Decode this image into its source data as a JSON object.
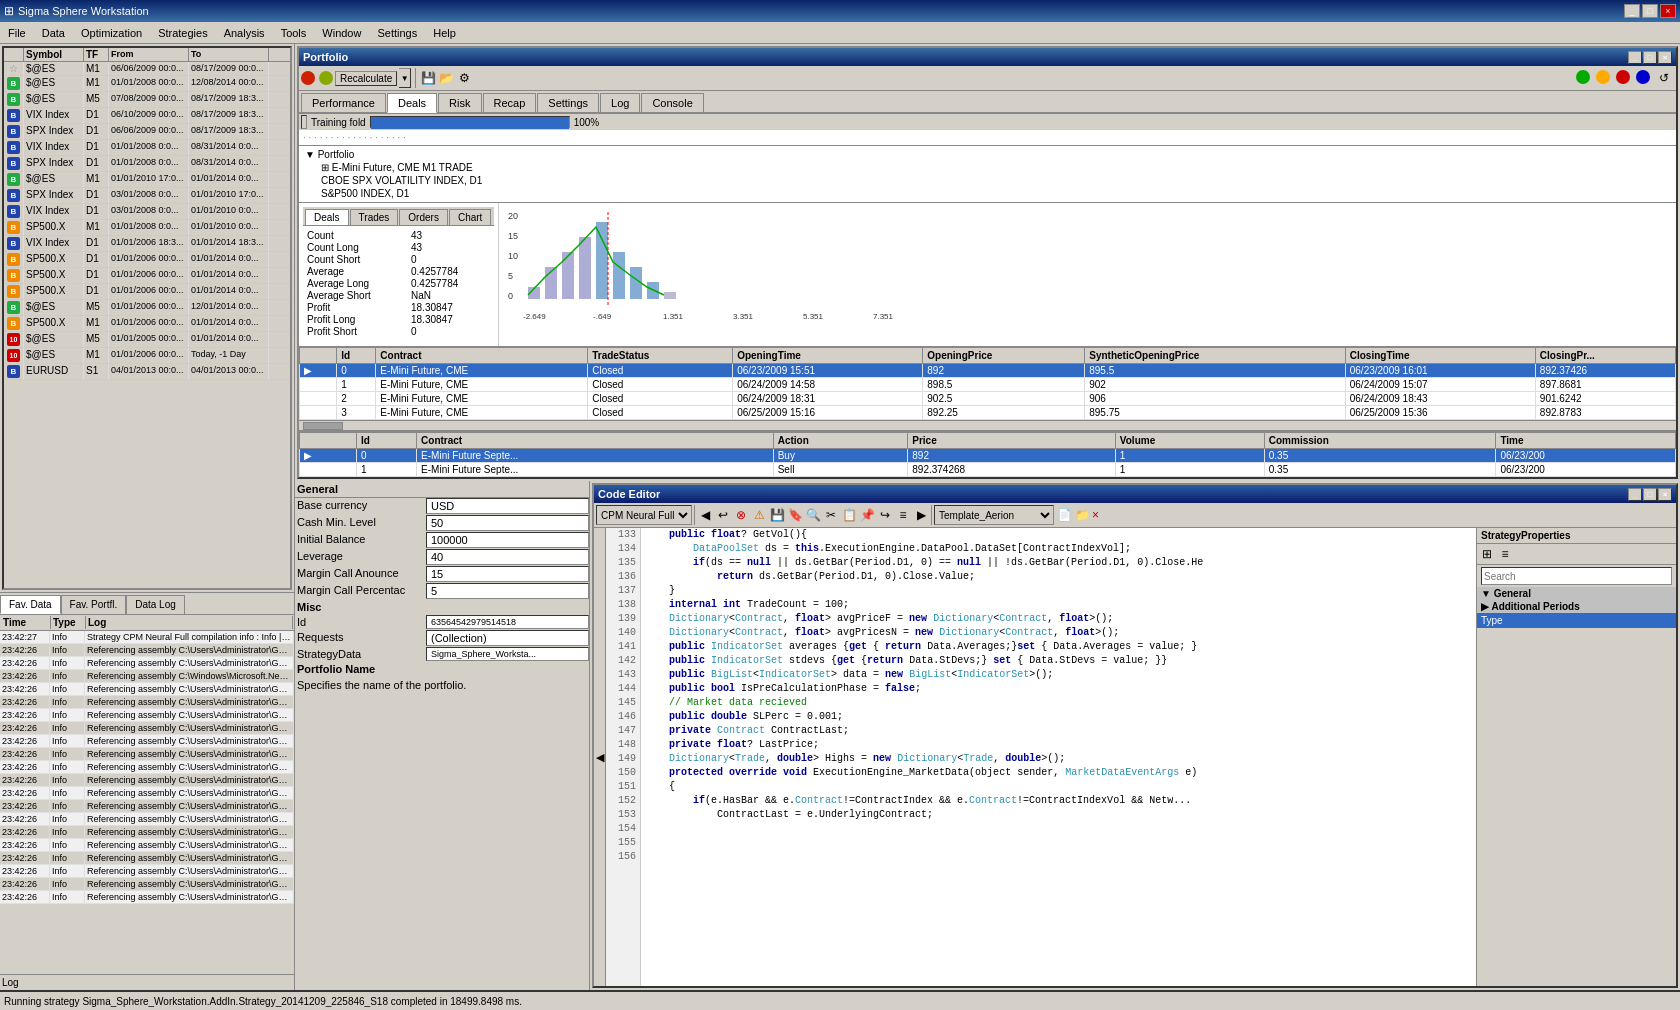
{
  "titleBar": {
    "title": "Sigma Sphere Workstation",
    "buttons": [
      "_",
      "□",
      "×"
    ]
  },
  "menuBar": {
    "items": [
      "File",
      "Data",
      "Optimization",
      "Strategies",
      "Analysis",
      "Tools",
      "Window",
      "Settings",
      "Help"
    ]
  },
  "symbolTable": {
    "headers": [
      "",
      "Symbol",
      "TF",
      "From",
      "To"
    ],
    "rows": [
      {
        "icon": "star",
        "symbol": "$@ES",
        "tf": "M1",
        "from": "06/06/2009 00:0...",
        "to": "08/17/2009 00:0...",
        "iconType": "star"
      },
      {
        "icon": "B",
        "symbol": "$@ES",
        "tf": "M1",
        "from": "01/01/2008 00:0...",
        "to": "12/08/2014 00:0...",
        "iconType": "b-green"
      },
      {
        "icon": "B",
        "symbol": "$@ES",
        "tf": "M5",
        "from": "07/08/2009 00:0...",
        "to": "08/17/2009 18:3...",
        "iconType": "b-green"
      },
      {
        "icon": "B",
        "symbol": "VIX Index",
        "tf": "D1",
        "from": "06/10/2009 00:0...",
        "to": "08/17/2009 18:3...",
        "iconType": "b-blue"
      },
      {
        "icon": "B",
        "symbol": "SPX Index",
        "tf": "D1",
        "from": "06/06/2009 00:0...",
        "to": "08/17/2009 18:3...",
        "iconType": "b-blue"
      },
      {
        "icon": "B",
        "symbol": "VIX Index",
        "tf": "D1",
        "from": "01/01/2008 0:0...",
        "to": "08/31/2014 0:0...",
        "iconType": "b-blue"
      },
      {
        "icon": "B",
        "symbol": "SPX Index",
        "tf": "D1",
        "from": "01/01/2008 0:0...",
        "to": "08/31/2014 0:0...",
        "iconType": "b-blue"
      },
      {
        "icon": "B",
        "symbol": "$@ES",
        "tf": "M1",
        "from": "01/01/2010 17:0...",
        "to": "01/01/2014 0:0...",
        "iconType": "b-green"
      },
      {
        "icon": "B",
        "symbol": "SPX Index",
        "tf": "D1",
        "from": "03/01/2008 0:0...",
        "to": "01/01/2010 17:0...",
        "iconType": "b-blue"
      },
      {
        "icon": "B",
        "symbol": "VIX Index",
        "tf": "D1",
        "from": "03/01/2008 0:0...",
        "to": "01/01/2010 0:0...",
        "iconType": "b-blue"
      },
      {
        "icon": "B",
        "symbol": "SP500.X",
        "tf": "M1",
        "from": "01/01/2008 0:0...",
        "to": "01/01/2010 0:0...",
        "iconType": "b-orange"
      },
      {
        "icon": "B",
        "symbol": "VIX Index",
        "tf": "D1",
        "from": "01/01/2006 18:3...",
        "to": "01/01/2014 18:3...",
        "iconType": "b-blue"
      },
      {
        "icon": "B",
        "symbol": "SP500.X",
        "tf": "D1",
        "from": "01/01/2006 00:0...",
        "to": "01/01/2014 0:0...",
        "iconType": "b-orange"
      },
      {
        "icon": "B",
        "symbol": "SP500.X",
        "tf": "D1",
        "from": "01/01/2006 00:0...",
        "to": "01/01/2014 0:0...",
        "iconType": "b-orange"
      },
      {
        "icon": "B",
        "symbol": "SP500.X",
        "tf": "D1",
        "from": "01/01/2006 00:0...",
        "to": "01/01/2014 0:0...",
        "iconType": "b-orange"
      },
      {
        "icon": "B",
        "symbol": "$@ES",
        "tf": "M5",
        "from": "01/01/2006 00:0...",
        "to": "12/01/2014 0:0...",
        "iconType": "b-green"
      },
      {
        "icon": "B",
        "symbol": "SP500.X",
        "tf": "M1",
        "from": "01/01/2006 00:0...",
        "to": "01/01/2014 0:0...",
        "iconType": "b-orange"
      },
      {
        "icon": "10",
        "symbol": "$@ES",
        "tf": "M5",
        "from": "01/01/2005 00:0...",
        "to": "01/01/2014 0:0...",
        "iconType": "ten-red"
      },
      {
        "icon": "10",
        "symbol": "$@ES",
        "tf": "M1",
        "from": "01/01/2006 00:0...",
        "to": "Today, -1 Day",
        "iconType": "ten-red"
      },
      {
        "icon": "B",
        "symbol": "EURUSD",
        "tf": "S1",
        "from": "04/01/2013 00:0...",
        "to": "04/01/2013 00:0...",
        "iconType": "b-blue"
      }
    ]
  },
  "leftTabs": [
    "Fav. Data",
    "Fav. Portfl.",
    "Data Log"
  ],
  "logPanel": {
    "headers": [
      "Time",
      "Type",
      "Log"
    ],
    "rows": [
      {
        "time": "23:42:27",
        "type": "Info",
        "log": "Strategy CPM Neural Full compilation info : Info | Compi"
      },
      {
        "time": "23:42:26",
        "type": "Info",
        "log": "Referencing assembly C:\\Users\\Administrator\\Google"
      },
      {
        "time": "23:42:26",
        "type": "Info",
        "log": "Referencing assembly C:\\Users\\Administrator\\Google"
      },
      {
        "time": "23:42:26",
        "type": "Info",
        "log": "Referencing assembly C:\\Windows\\Microsoft.Net\\ass"
      },
      {
        "time": "23:42:26",
        "type": "Info",
        "log": "Referencing assembly C:\\Users\\Administrator\\Google"
      },
      {
        "time": "23:42:26",
        "type": "Info",
        "log": "Referencing assembly C:\\Users\\Administrator\\Google"
      },
      {
        "time": "23:42:26",
        "type": "Info",
        "log": "Referencing assembly C:\\Users\\Administrator\\Google"
      },
      {
        "time": "23:42:26",
        "type": "Info",
        "log": "Referencing assembly C:\\Users\\Administrator\\Google"
      },
      {
        "time": "23:42:26",
        "type": "Info",
        "log": "Referencing assembly C:\\Users\\Administrator\\Google"
      },
      {
        "time": "23:42:26",
        "type": "Info",
        "log": "Referencing assembly C:\\Users\\Administrator\\Google"
      },
      {
        "time": "23:42:26",
        "type": "Info",
        "log": "Referencing assembly C:\\Users\\Administrator\\Google"
      },
      {
        "time": "23:42:26",
        "type": "Info",
        "log": "Referencing assembly C:\\Users\\Administrator\\Google"
      },
      {
        "time": "23:42:26",
        "type": "Info",
        "log": "Referencing assembly C:\\Users\\Administrator\\Google"
      },
      {
        "time": "23:42:26",
        "type": "Info",
        "log": "Referencing assembly C:\\Users\\Administrator\\Google"
      },
      {
        "time": "23:42:26",
        "type": "Info",
        "log": "Referencing assembly C:\\Users\\Administrator\\Google"
      },
      {
        "time": "23:42:26",
        "type": "Info",
        "log": "Referencing assembly C:\\Users\\Administrator\\Google"
      },
      {
        "time": "23:42:26",
        "type": "Info",
        "log": "Referencing assembly C:\\Users\\Administrator\\Google"
      },
      {
        "time": "23:42:26",
        "type": "Info",
        "log": "Referencing assembly C:\\Users\\Administrator\\Google"
      },
      {
        "time": "23:42:26",
        "type": "Info",
        "log": "Referencing assembly C:\\Users\\Administrator\\Google"
      },
      {
        "time": "23:42:26",
        "type": "Info",
        "log": "Referencing assembly C:\\Users\\Administrator\\Google"
      },
      {
        "time": "23:42:26",
        "type": "Info",
        "log": "Referencing assembly C:\\Users\\Administrator\\Google"
      }
    ]
  },
  "logLabel": "Log",
  "portfolio": {
    "title": "Portfolio",
    "tabs": [
      "Performance",
      "Deals",
      "Risk",
      "Recap",
      "Settings",
      "Log",
      "Console"
    ],
    "activeTab": "Deals",
    "dealsTabs": [
      "Deals",
      "Trades",
      "Orders",
      "Chart"
    ],
    "activeDealsTab": "Deals",
    "stats": {
      "count": "43",
      "countLong": "43",
      "countShort": "0",
      "average": "0.4257784",
      "averageLong": "0.4257784",
      "averageShort": "NaN",
      "profit": "18.30847",
      "profitLong": "18.30847",
      "profitShort": "0"
    },
    "tradesTableHeaders": [
      "Id",
      "Contract",
      "TradeStatus",
      "OpeningTime",
      "OpeningPrice",
      "SyntheticOpeningPrice",
      "ClosingTime",
      "ClosingPr..."
    ],
    "tradesRows": [
      {
        "id": "0",
        "contract": "E-Mini Future, CME",
        "status": "Closed",
        "openTime": "06/23/2009 15:51",
        "openPrice": "892",
        "synthOpen": "895.5",
        "closeTime": "06/23/2009 16:01",
        "closePrice": "892.37426"
      },
      {
        "id": "1",
        "contract": "E-Mini Future, CME",
        "status": "Closed",
        "openTime": "06/24/2009 14:58",
        "openPrice": "898.5",
        "synthOpen": "902",
        "closeTime": "06/24/2009 15:07",
        "closePrice": "897.8681"
      },
      {
        "id": "2",
        "contract": "E-Mini Future, CME",
        "status": "Closed",
        "openTime": "06/24/2009 18:31",
        "openPrice": "902.5",
        "synthOpen": "906",
        "closeTime": "06/24/2009 18:43",
        "closePrice": "901.6242"
      },
      {
        "id": "3",
        "contract": "E-Mini Future, CME",
        "status": "Closed",
        "openTime": "06/25/2009 15:16",
        "openPrice": "892.25",
        "synthOpen": "895.75",
        "closeTime": "06/25/2009 15:36",
        "closePrice": "892.8783"
      }
    ],
    "ordersTableHeaders": [
      "Id",
      "Contract",
      "Action",
      "Price",
      "Volume",
      "Commission",
      "Time"
    ],
    "ordersRows": [
      {
        "id": "0",
        "contract": "E-Mini Future Septe...",
        "action": "Buy",
        "price": "892",
        "volume": "1",
        "commission": "0.35",
        "time": "06/23/200"
      },
      {
        "id": "1",
        "contract": "E-Mini Future Septe...",
        "action": "Sell",
        "price": "892.374268",
        "volume": "1",
        "commission": "0.35",
        "time": "06/23/200"
      }
    ]
  },
  "general": {
    "title": "General",
    "baseCurrency": {
      "label": "Base currency",
      "value": "USD"
    },
    "cashMin": {
      "label": "Cash Min. Level",
      "value": "50"
    },
    "initialBalance": {
      "label": "Initial Balance",
      "value": "100000"
    },
    "leverage": {
      "label": "Leverage",
      "value": "40"
    },
    "marginCallAnnounce": {
      "label": "Margin Call Anounce",
      "value": "15"
    },
    "marginCallPercentage": {
      "label": "Margin Call Percentac",
      "value": "5"
    },
    "portfolioName": {
      "label": "Portfolio Name",
      "value": ""
    },
    "misc": {
      "id": "63564542979514518",
      "requests": "(Collection)",
      "strategyData": "Sigma_Sphere_Worksta..."
    },
    "description": "Specifies the name of the portfolio."
  },
  "codeEditor": {
    "title": "Code Editor",
    "strategyName": "CPM Neural Full",
    "templateName": "Template_Aerion",
    "lines": [
      {
        "num": 133,
        "code": ""
      },
      {
        "num": 134,
        "code": "    public float? GetVol(){"
      },
      {
        "num": 135,
        "code": "        DataPoolSet ds = this.ExecutionEngine.DataPool.DataSet[ContractIndexVol];"
      },
      {
        "num": 136,
        "code": "        if(ds == null || ds.GetBar(Period.D1, 0) == null || !ds.GetBar(Period.D1, 0).Close.He"
      },
      {
        "num": 137,
        "code": "            return ds.GetBar(Period.D1, 0).Close.Value;"
      },
      {
        "num": 138,
        "code": "    }"
      },
      {
        "num": 139,
        "code": ""
      },
      {
        "num": 140,
        "code": "    internal int TradeCount = 100;"
      },
      {
        "num": 141,
        "code": "    Dictionary<Contract, float> avgPriceF = new Dictionary<Contract, float>();"
      },
      {
        "num": 142,
        "code": "    Dictionary<Contract, float> avgPricesN = new Dictionary<Contract, float>();"
      },
      {
        "num": 143,
        "code": "    public IndicatorSet averages {get { return Data.Averages;}set { Data.Averages = value; }"
      },
      {
        "num": 144,
        "code": "    public IndicatorSet stdevs {get {return Data.StDevs;} set { Data.StDevs = value; }}"
      },
      {
        "num": 145,
        "code": "    public BigList<IndicatorSet> data = new BigList<IndicatorSet>();"
      },
      {
        "num": 146,
        "code": "    public bool IsPreCalculationPhase = false;"
      },
      {
        "num": 147,
        "code": "    // Market data recieved"
      },
      {
        "num": 148,
        "code": ""
      },
      {
        "num": 149,
        "code": "    public double SLPerc = 0.001;"
      },
      {
        "num": 150,
        "code": "    private Contract ContractLast;"
      },
      {
        "num": 151,
        "code": "    private float? LastPrice;"
      },
      {
        "num": 152,
        "code": "    Dictionary<Trade, double> Highs = new Dictionary<Trade, double>();"
      },
      {
        "num": 153,
        "code": "    protected override void ExecutionEngine_MarketData(object sender, MarketDataEventArgs e)"
      },
      {
        "num": 154,
        "code": "    {"
      },
      {
        "num": 155,
        "code": "        if(e.HasBar && e.Contract!=ContractIndex && e.Contract!=ContractIndexVol && Netw..."
      },
      {
        "num": 156,
        "code": "            ContractLast = e.UnderlyingContract;"
      }
    ],
    "sidebar": {
      "searchPlaceholder": "Search",
      "treeItems": [
        {
          "label": "General",
          "expanded": true
        },
        {
          "label": "Additional Periods",
          "expanded": false
        },
        {
          "label": "Type",
          "selected": true
        }
      ]
    }
  },
  "statusBar": {
    "text": "Running strategy Sigma_Sphere_Workstation.AddIn.Strategy_20141209_225846_S18 completed in 18499.8498 ms."
  },
  "progressBar": {
    "label": "Training fold",
    "percent": "100%",
    "value": 100
  },
  "portfolioTree": {
    "items": [
      {
        "label": "Portfolio",
        "level": 0,
        "expanded": true
      },
      {
        "label": "E-Mini Future, CME M1 TRADE",
        "level": 1
      },
      {
        "label": "CBOE SPX VOLATILITY INDEX, D1",
        "level": 1
      },
      {
        "label": "S&P500 INDEX, D1",
        "level": 1
      }
    ]
  }
}
